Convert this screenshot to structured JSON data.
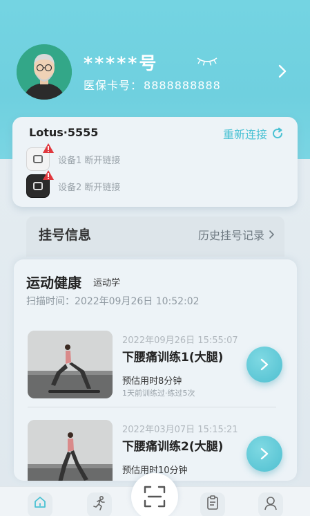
{
  "profile": {
    "name_masked": "*****号",
    "card_label": "医保卡号：",
    "card_number": "8888888888"
  },
  "device_card": {
    "title": "Lotus·5555",
    "reconnect_label": "重新连接",
    "devices": [
      {
        "label": "设备1 断开链接",
        "style": "light",
        "status": "warning"
      },
      {
        "label": "设备2 断开链接",
        "style": "dark",
        "status": "warning"
      }
    ]
  },
  "registration": {
    "title": "挂号信息",
    "history_label": "历史挂号记录"
  },
  "sport": {
    "title": "运动健康",
    "subtitle": "运动学",
    "scan_time": "扫描时间：2022年09月26日 10:52:02",
    "exercises": [
      {
        "date": "2022年09月26日 15:55:07",
        "name": "下腰痛训练1(大腿)",
        "estimate": "预估用时8分钟",
        "last": "1天前训练过·练过5次"
      },
      {
        "date": "2022年03月07日 15:15:21",
        "name": "下腰痛训练2(大腿)",
        "estimate": "预估用时10分钟",
        "last": ""
      }
    ]
  },
  "tabbar": {
    "items": [
      "home-icon",
      "run-icon",
      "scan-icon",
      "clipboard-icon",
      "user-icon"
    ]
  },
  "colors": {
    "accent": "#4fbfd0",
    "hero": "#74d4e2",
    "warning": "#e0383e"
  }
}
